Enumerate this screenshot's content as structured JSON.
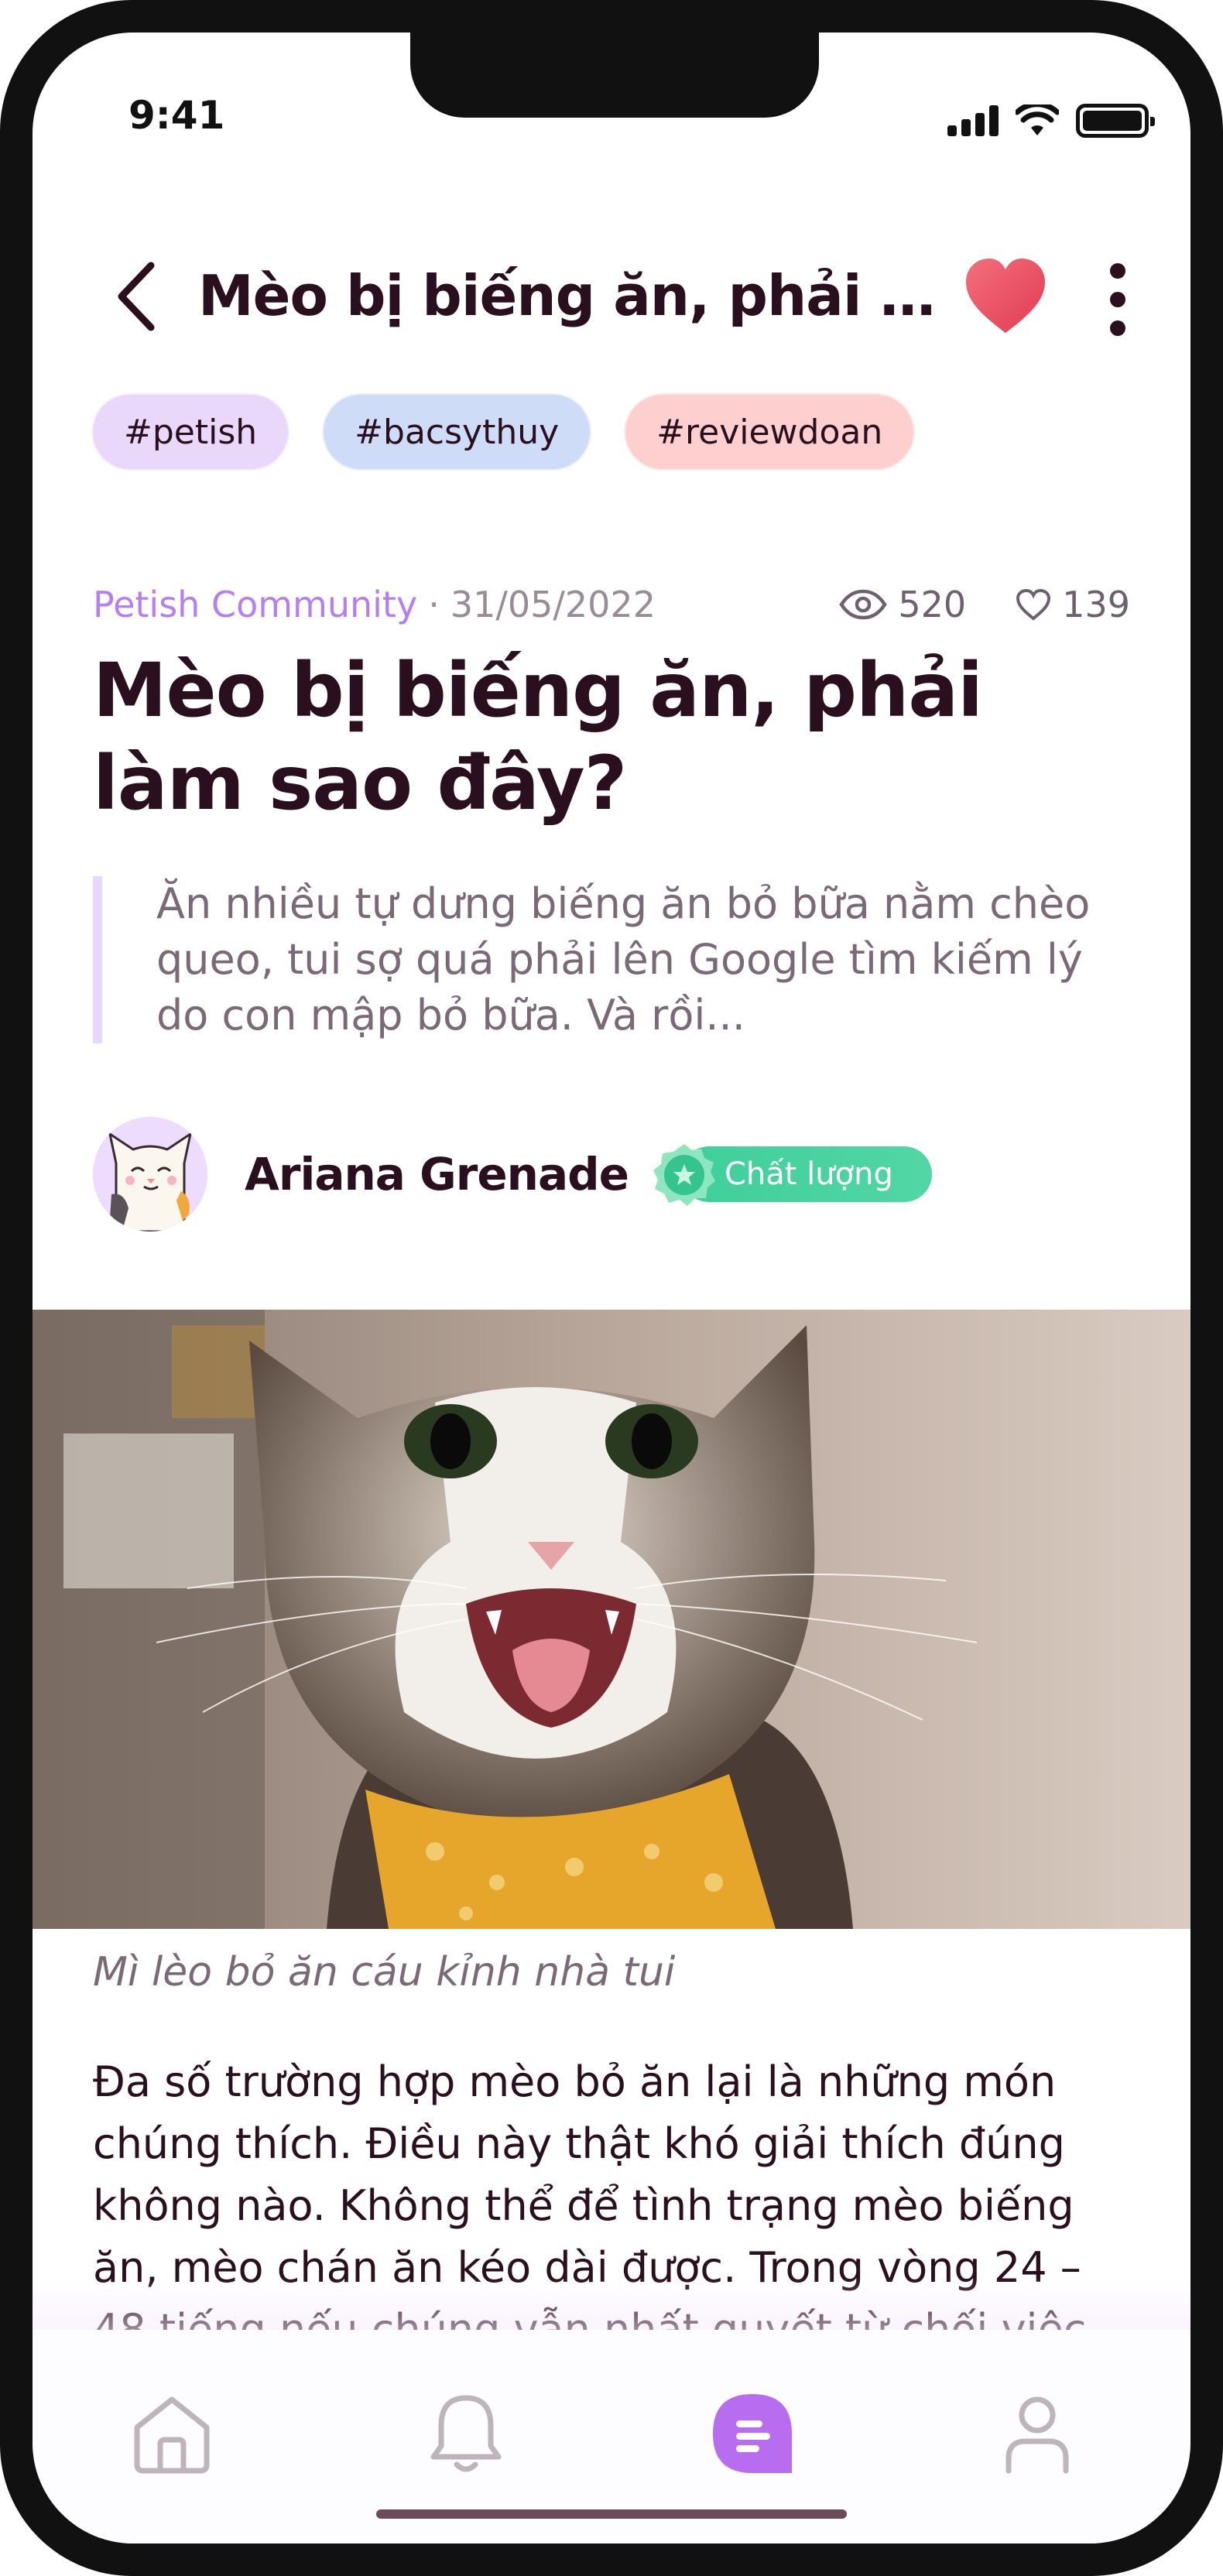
{
  "status_bar": {
    "time": "9:41"
  },
  "header": {
    "title": "Mèo bị biếng ăn, phải làm...",
    "favorite_color": "#e8485c"
  },
  "tags": [
    {
      "label": "#petish",
      "color": "#ead8fb"
    },
    {
      "label": "#bacsythuy",
      "color": "#cfdcf8"
    },
    {
      "label": "#reviewdoan",
      "color": "#fdd0cf"
    }
  ],
  "meta": {
    "community": "Petish Community",
    "date": "31/05/2022",
    "views": "520",
    "likes": "139"
  },
  "article": {
    "title": "Mèo bị biếng ăn, phải làm sao đây?",
    "excerpt": "Ăn nhiều tự dưng biếng ăn bỏ bữa nằm chèo queo, tui sợ quá phải lên Google tìm kiếm lý do con mập bỏ bữa. Và rồi...",
    "author": "Ariana Grenade",
    "badge": "Chất lượng",
    "image_caption": "Mì lèo bỏ ăn cáu kỉnh nhà tui",
    "body": "Đa số trường hợp mèo bỏ ăn lại là những món chúng thích. Điều này thật khó giải thích đúng không nào. Không thể để tình trạng mèo biếng ăn, mèo chán ăn kéo dài được. Trong vòng 24 – 48 tiếng nếu chúng vẫn nhất quyết từ chối việc ăn thì"
  },
  "tabbar": {
    "items": [
      {
        "name": "home",
        "icon": "home-icon",
        "active": false
      },
      {
        "name": "notifications",
        "icon": "bell-icon",
        "active": false
      },
      {
        "name": "articles",
        "icon": "articles-icon",
        "active": true
      },
      {
        "name": "profile",
        "icon": "profile-icon",
        "active": false
      }
    ],
    "active_color": "#b86df0",
    "inactive_color": "#bdb5bb"
  }
}
